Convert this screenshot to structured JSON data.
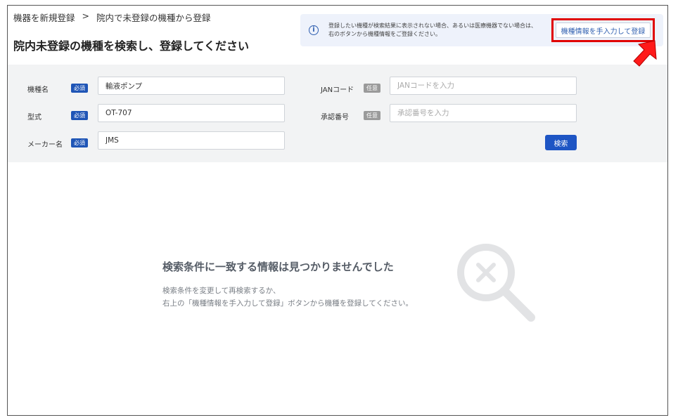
{
  "breadcrumb": {
    "items": [
      "機器を新規登録",
      "院内で未登録の機種から登録"
    ],
    "separator": ">"
  },
  "page_title": "院内未登録の機種を検索し、登録してください",
  "info": {
    "line1": "登録したい機種が検索結果に表示されない場合、あるいは医療機器でない場合は、",
    "line2": "右のボタンから機種情報をご登録ください。",
    "manual_button": "機種情報を手入力して登録",
    "icon": "info-icon"
  },
  "form": {
    "model_name": {
      "label": "機種名",
      "badge": "必須",
      "value": "輸液ポンプ"
    },
    "type": {
      "label": "型式",
      "badge": "必須",
      "value": "OT-707"
    },
    "maker": {
      "label": "メーカー名",
      "badge": "必須",
      "value": "JMS"
    },
    "jan": {
      "label": "JANコード",
      "badge": "任意",
      "placeholder": "JANコードを入力"
    },
    "approval": {
      "label": "承認番号",
      "badge": "任意",
      "placeholder": "承認番号を入力"
    },
    "search_button": "検索"
  },
  "empty_state": {
    "title": "検索条件に一致する情報は見つかりませんでした",
    "line1": "検索条件を変更して再検索するか、",
    "line2": "右上の「機種情報を手入力して登録」ボタンから機種を登録してください。",
    "icon": "search-no-results-icon"
  },
  "colors": {
    "primary": "#1e55c4",
    "required_badge": "#1f55b6",
    "optional_badge": "#9a9a9a",
    "highlight": "#e00000",
    "panel_bg": "#f2f3f4",
    "info_bg": "#eef2fb"
  }
}
